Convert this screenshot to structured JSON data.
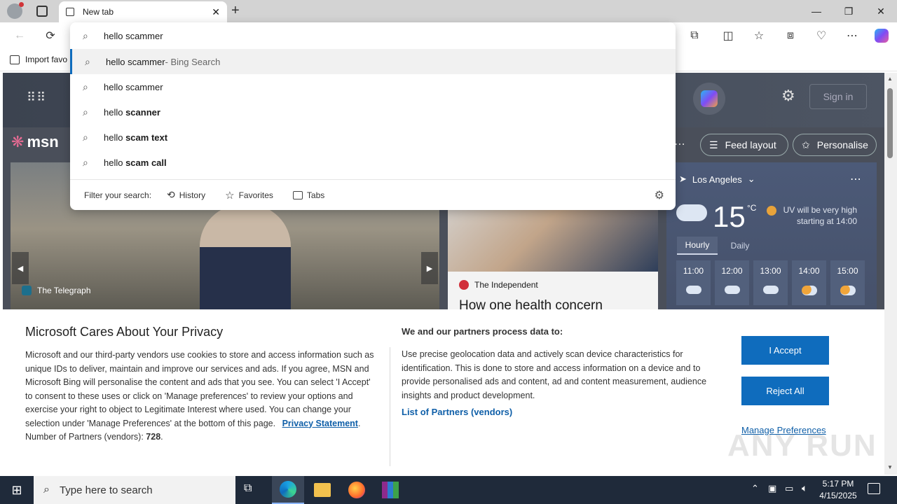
{
  "tab": {
    "title": "New tab"
  },
  "omnibox": {
    "query": "hello scammer"
  },
  "suggestions": [
    {
      "prefix": "hello scammer",
      "bold": "",
      "suffix": " - Bing Search"
    },
    {
      "prefix": "hello scammer",
      "bold": "",
      "suffix": ""
    },
    {
      "prefix": "hello ",
      "bold": "scanner",
      "suffix": ""
    },
    {
      "prefix": "hello ",
      "bold": "scam text",
      "suffix": ""
    },
    {
      "prefix": "hello ",
      "bold": "scam call",
      "suffix": ""
    }
  ],
  "filter": {
    "label": "Filter your search:",
    "history": "History",
    "favorites": "Favorites",
    "tabs": "Tabs"
  },
  "favbar": {
    "import": "Import favo"
  },
  "msn": {
    "logo": "msn",
    "sign_in": "Sign in",
    "feed_layout": "Feed layout",
    "personalise": "Personalise"
  },
  "news": {
    "source1": "The Telegraph",
    "source2": "The Independent",
    "headline2": "How one health concern"
  },
  "weather": {
    "location": "Los Angeles",
    "temp": "15",
    "unit": "°C",
    "uv": "UV will be very high starting at 14:00",
    "tab_hourly": "Hourly",
    "tab_daily": "Daily",
    "hours": [
      "11:00",
      "12:00",
      "13:00",
      "14:00",
      "15:00"
    ]
  },
  "privacy": {
    "title": "Microsoft Cares About Your Privacy",
    "body": "Microsoft and our third-party vendors use cookies to store and access information such as unique IDs to deliver, maintain and improve our services and ads. If you agree, MSN and Microsoft Bing will personalise the content and ads that you see. You can select 'I Accept' to consent to these uses or click on 'Manage preferences' to review your options and exercise your right to object to Legitimate Interest where used.  You can change your selection under 'Manage Preferences' at the bottom of this page.",
    "link": "Privacy Statement",
    "partners_label": "Number of Partners (vendors):",
    "partners_count": "728",
    "right_title": "We and our partners process data to:",
    "right_body": "Use precise geolocation data and actively scan device characteristics for identification. This is done to store and access information on a device and to provide personalised ads and content, ad and content measurement, audience insights and product development.",
    "vendors_link": "List of Partners (vendors)",
    "accept": "I Accept",
    "reject": "Reject All",
    "manage": "Manage Preferences"
  },
  "taskbar": {
    "search": "Type here to search",
    "time": "5:17 PM",
    "date": "4/15/2025"
  },
  "watermark": "ANY RUN"
}
